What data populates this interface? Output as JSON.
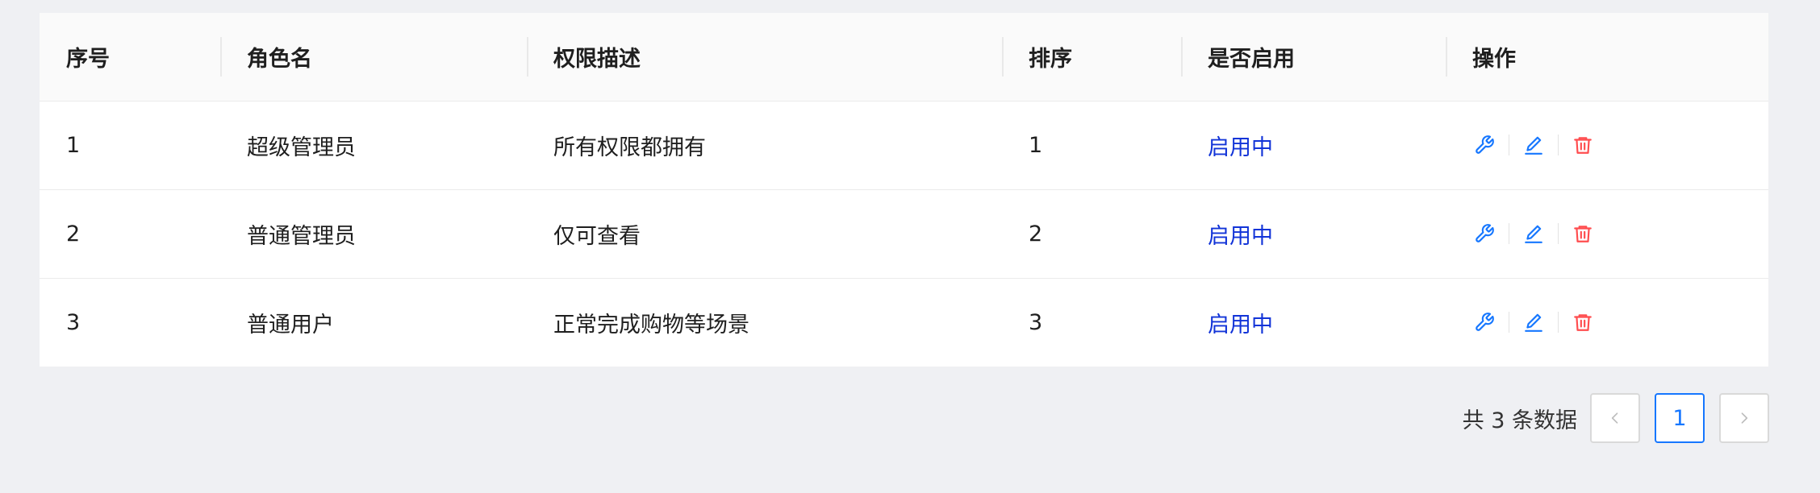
{
  "table": {
    "headers": [
      "序号",
      "角色名",
      "权限描述",
      "排序",
      "是否启用",
      "操作"
    ],
    "rows": [
      {
        "index": "1",
        "role": "超级管理员",
        "desc": "所有权限都拥有",
        "sort": "1",
        "status": "启用中"
      },
      {
        "index": "2",
        "role": "普通管理员",
        "desc": "仅可查看",
        "sort": "2",
        "status": "启用中"
      },
      {
        "index": "3",
        "role": "普通用户",
        "desc": "正常完成购物等场景",
        "sort": "3",
        "status": "启用中"
      }
    ],
    "row_actions": [
      "wrench-icon",
      "edit-icon",
      "delete-icon"
    ]
  },
  "pagination": {
    "total_label": "共 3 条数据",
    "current_page": "1",
    "prev_label": "<",
    "next_label": ">"
  },
  "colors": {
    "status": "#1234d8",
    "icon_blue": "#1677ff",
    "icon_red": "#ff4d4f",
    "page_bg": "#eff0f3"
  }
}
